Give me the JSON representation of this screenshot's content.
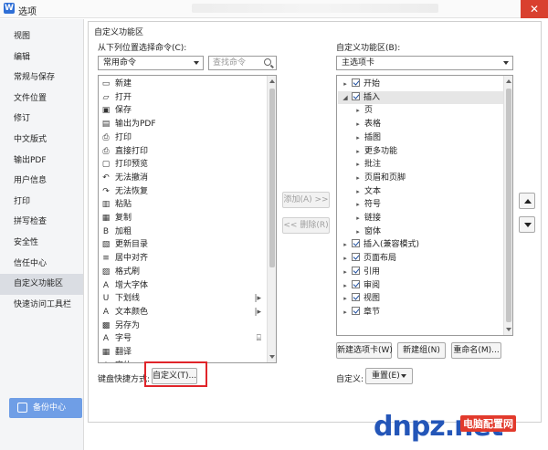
{
  "window": {
    "title": "选项",
    "close": "✕"
  },
  "sidebar": {
    "items": [
      {
        "label": "视图"
      },
      {
        "label": "编辑"
      },
      {
        "label": "常规与保存"
      },
      {
        "label": "文件位置"
      },
      {
        "label": "修订"
      },
      {
        "label": "中文版式"
      },
      {
        "label": "输出PDF"
      },
      {
        "label": "用户信息"
      },
      {
        "label": "打印"
      },
      {
        "label": "拼写检查"
      },
      {
        "label": "安全性"
      },
      {
        "label": "信任中心"
      },
      {
        "label": "自定义功能区",
        "active": true
      },
      {
        "label": "快速访问工具栏"
      }
    ],
    "backup_label": "备份中心"
  },
  "panel": {
    "title": "自定义功能区",
    "left_label": "从下列位置选择命令(C):",
    "left_select": "常用命令",
    "search_placeholder": "查找命令",
    "commands": [
      {
        "label": "新建",
        "icon": "▭"
      },
      {
        "label": "打开",
        "icon": "▱"
      },
      {
        "label": "保存",
        "icon": "▣"
      },
      {
        "label": "输出为PDF",
        "icon": "▤"
      },
      {
        "label": "打印",
        "icon": "⎙"
      },
      {
        "label": "直接打印",
        "icon": "⎙"
      },
      {
        "label": "打印预览",
        "icon": "▢"
      },
      {
        "label": "无法撤消",
        "icon": "↶"
      },
      {
        "label": "无法恢复",
        "icon": "↷"
      },
      {
        "label": "粘贴",
        "icon": "▥"
      },
      {
        "label": "复制",
        "icon": "▦"
      },
      {
        "label": "加粗",
        "icon": "B"
      },
      {
        "label": "更新目录",
        "icon": "▧"
      },
      {
        "label": "居中对齐",
        "icon": "≡"
      },
      {
        "label": "格式刷",
        "icon": "▨"
      },
      {
        "label": "增大字体",
        "icon": "A"
      },
      {
        "label": "下划线",
        "icon": "U",
        "sub": "|▸"
      },
      {
        "label": "文本颜色",
        "icon": "A",
        "sub": "|▸"
      },
      {
        "label": "另存为",
        "icon": "▩"
      },
      {
        "label": "字号",
        "icon": "A",
        "sub": "⌸"
      },
      {
        "label": "翻译",
        "icon": "▦"
      },
      {
        "label": "字体",
        "icon": "A"
      }
    ],
    "add_button": "添加(A) >>",
    "remove_button": "<< 删除(R)",
    "right_label": "自定义功能区(B):",
    "right_select": "主选项卡",
    "tree": [
      {
        "label": "开始",
        "level": 0,
        "toggle": "▸",
        "checked": true
      },
      {
        "label": "插入",
        "level": 0,
        "toggle": "◢",
        "checked": true,
        "selected": true
      },
      {
        "label": "页",
        "level": 1,
        "toggle": "▸"
      },
      {
        "label": "表格",
        "level": 1,
        "toggle": "▸"
      },
      {
        "label": "插图",
        "level": 1,
        "toggle": "▸"
      },
      {
        "label": "更多功能",
        "level": 1,
        "toggle": "▸"
      },
      {
        "label": "批注",
        "level": 1,
        "toggle": "▸"
      },
      {
        "label": "页眉和页脚",
        "level": 1,
        "toggle": "▸"
      },
      {
        "label": "文本",
        "level": 1,
        "toggle": "▸"
      },
      {
        "label": "符号",
        "level": 1,
        "toggle": "▸"
      },
      {
        "label": "链接",
        "level": 1,
        "toggle": "▸"
      },
      {
        "label": "窗体",
        "level": 1,
        "toggle": "▸"
      },
      {
        "label": "插入(兼容模式)",
        "level": 0,
        "toggle": "▸",
        "checked": true
      },
      {
        "label": "页面布局",
        "level": 0,
        "toggle": "▸",
        "checked": true
      },
      {
        "label": "引用",
        "level": 0,
        "toggle": "▸",
        "checked": true
      },
      {
        "label": "审阅",
        "level": 0,
        "toggle": "▸",
        "checked": true
      },
      {
        "label": "视图",
        "level": 0,
        "toggle": "▸",
        "checked": true
      },
      {
        "label": "章节",
        "level": 0,
        "toggle": "▸",
        "checked": true
      }
    ],
    "new_tab_button": "新建选项卡(W)",
    "new_group_button": "新建组(N)",
    "rename_button": "重命名(M)...",
    "keyboard_label": "键盘快捷方式:",
    "customize_button": "自定义(T)...",
    "custom_label": "自定义:",
    "reset_button": "重置(E)"
  },
  "watermark": {
    "brand": "dnpz.net",
    "text": "电脑配置网"
  }
}
